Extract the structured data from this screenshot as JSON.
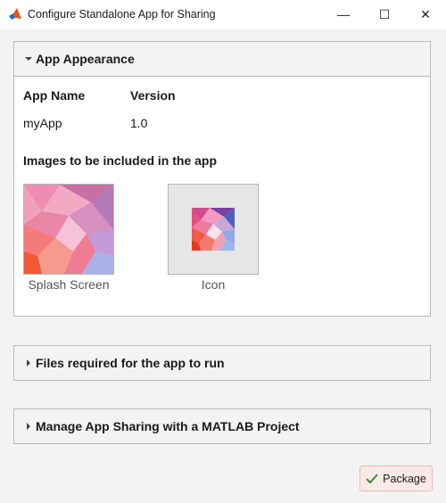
{
  "window": {
    "title": "Configure Standalone App for Sharing",
    "controls": {
      "minimize": "—",
      "maximize": "☐",
      "close": "✕"
    }
  },
  "app_appearance": {
    "header": "App Appearance",
    "expanded": true,
    "columns": {
      "name_label": "App Name",
      "version_label": "Version"
    },
    "values": {
      "name": "myApp",
      "version": "1.0"
    },
    "images_label": "Images to be included in the app",
    "images": {
      "splash_label": "Splash Screen",
      "icon_label": "Icon"
    }
  },
  "files_panel": {
    "header": "Files required for the app to run",
    "expanded": false
  },
  "project_panel": {
    "header": "Manage App Sharing with a MATLAB Project",
    "expanded": false
  },
  "actions": {
    "package_label": "Package"
  },
  "colors": {
    "accent_check": "#3a8a3a",
    "package_bg": "#fbe9ea",
    "package_border": "#e8b7bc",
    "matlab_orange": "#e0581b"
  }
}
